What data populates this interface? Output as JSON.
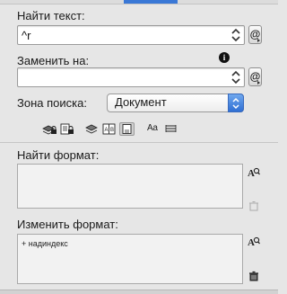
{
  "find": {
    "label": "Найти текст:",
    "value": "^r"
  },
  "replace": {
    "label": "Заменить на:",
    "value": ""
  },
  "scope": {
    "label": "Зона поиска:",
    "selected": "Документ"
  },
  "options": {
    "case_label": "Aa",
    "icons": [
      "locked-layers-icon",
      "locked-stories-icon",
      "hidden-layers-icon",
      "master-pages-icon",
      "footnotes-icon",
      "case-sensitive-icon",
      "whole-word-icon"
    ]
  },
  "find_format": {
    "label": "Найти формат:",
    "lines": []
  },
  "change_format": {
    "label": "Изменить формат:",
    "lines": [
      "+ надиндекс"
    ]
  },
  "colors": {
    "accent": "#3a78d6",
    "panel": "#e6e6e6",
    "box": "#f2f2f2"
  }
}
